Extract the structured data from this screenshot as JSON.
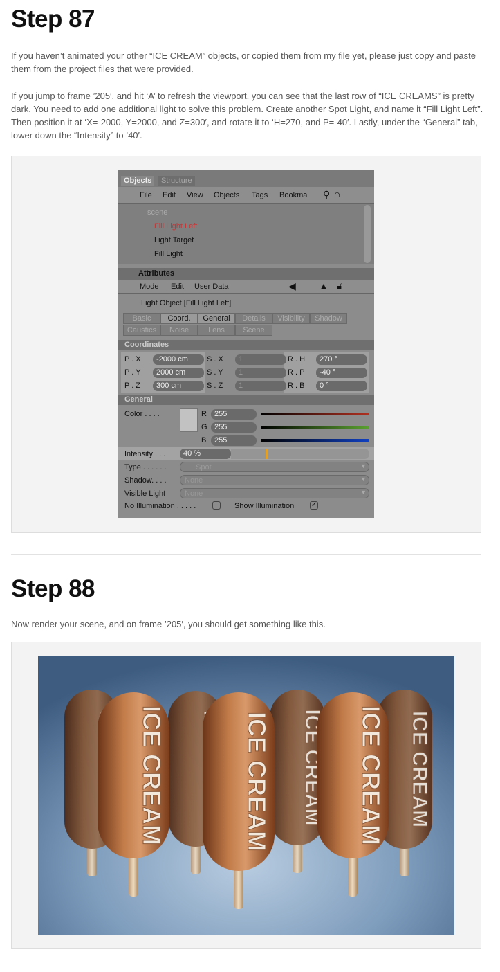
{
  "step87": {
    "title": "Step 87",
    "para1": "If you haven’t animated your other “ICE CREAM” objects, or copied them from my file yet, please just copy and paste them from the project files that were provided.",
    "para2": "If you jump to frame ’205′, and hit ‘A’ to refresh the viewport, you can see that the last row of “ICE CREAMS” is pretty dark. You need to add one additional light to solve this problem. Create another Spot Light, and name it “Fill Light Left”. Then position it at ‘X=-2000, Y=2000, and Z=300′, and rotate it to ‘H=270, and P=-40′. Lastly, under the “General” tab, lower down the “Intensity” to ’40′."
  },
  "panel": {
    "tabs": [
      "Objects",
      "Structure"
    ],
    "menu": [
      "File",
      "Edit",
      "View",
      "Objects",
      "Tags",
      "Bookma"
    ],
    "tree": [
      "scene",
      "Fill Light Left",
      "Light Target",
      "Fill Light"
    ],
    "attributes": "Attributes",
    "attr_menu": [
      "Mode",
      "Edit",
      "User Data"
    ],
    "object_title": "Light Object [Fill Light Left]",
    "attr_tabs": [
      "Basic",
      "Coord.",
      "General",
      "Details",
      "Visibility",
      "Shadow",
      "Caustics",
      "Noise",
      "Lens",
      "Scene"
    ],
    "coordinates": "Coordinates",
    "pos": [
      {
        "label": "P . X",
        "value": "-2000 cm"
      },
      {
        "label": "P . Y",
        "value": "2000 cm"
      },
      {
        "label": "P . Z",
        "value": "300 cm"
      }
    ],
    "scale": [
      {
        "label": "S . X",
        "value": "1"
      },
      {
        "label": "S . Y",
        "value": "1"
      },
      {
        "label": "S . Z",
        "value": "1"
      }
    ],
    "rot": [
      {
        "label": "R . H",
        "value": "270 °"
      },
      {
        "label": "R . P",
        "value": "-40 °"
      },
      {
        "label": "R . B",
        "value": "0 °"
      }
    ],
    "general": "General",
    "color_label": "Color . . . .",
    "rgb": [
      {
        "label": "R",
        "value": "255",
        "color": "#b03020"
      },
      {
        "label": "G",
        "value": "255",
        "color": "#5aa030"
      },
      {
        "label": "B",
        "value": "255",
        "color": "#1040c0"
      }
    ],
    "intensity_label": "Intensity . . .",
    "intensity_value": "40 %",
    "intensity_percent": 40,
    "type_label": "Type . . . . . .",
    "type_value": "Spot",
    "shadow_label": "Shadow. . . .",
    "shadow_value": "None",
    "visible_label": "Visible Light",
    "visible_value": "None",
    "no_illum": "No Illumination . . . . .",
    "show_illum": "Show Illumination"
  },
  "step88": {
    "title": "Step 88",
    "para": "Now render your scene, and on frame ’205′, you should get something like this.",
    "popsicle_text": "ICE CREAM"
  }
}
